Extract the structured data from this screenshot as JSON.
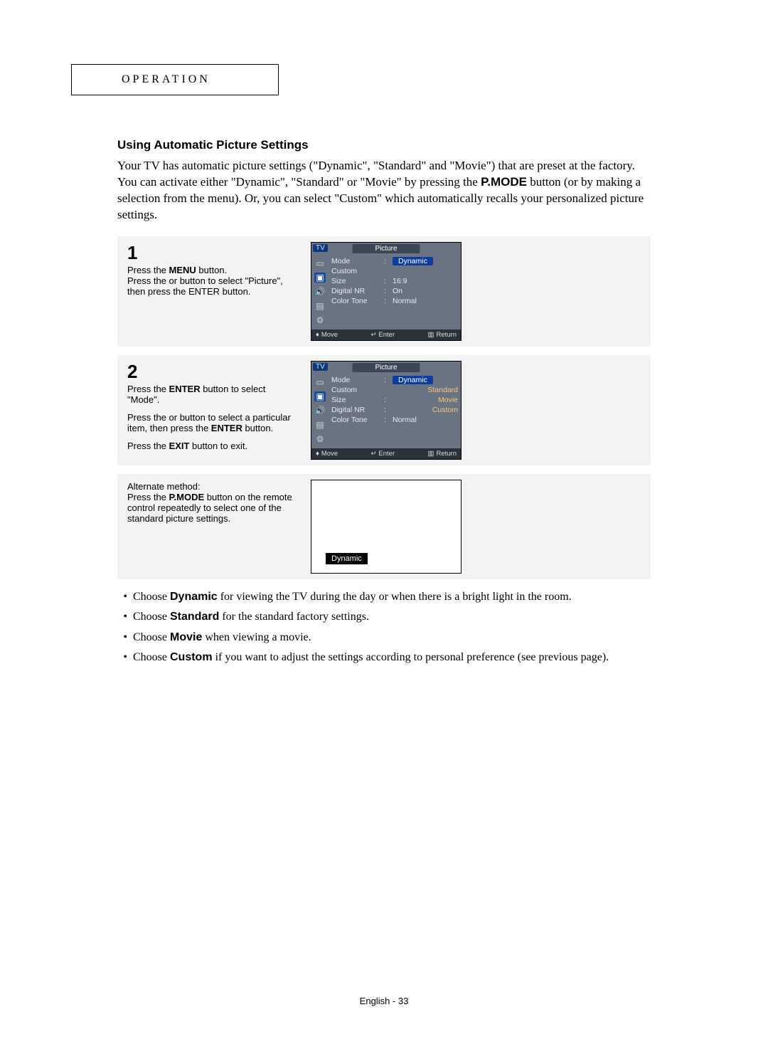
{
  "tab_label": "OPERATION",
  "section_title": "Using Automatic Picture Settings",
  "intro_part1": "Your TV has automatic picture settings (\"Dynamic\", \"Standard\" and \"Movie\") that are preset at the factory. You can activate either \"Dynamic\", \"Standard\" or \"Movie\" by pressing the ",
  "intro_bold": "P.MODE",
  "intro_part2": " button (or by making a selection from the menu). Or, you can select \"Custom\" which automatically recalls your personalized picture settings.",
  "step1": {
    "num": "1",
    "line1a": "Press the ",
    "line1b": "MENU",
    "line1c": " button.",
    "line2": "Press the      or      button to select \"Picture\", then press the ENTER button."
  },
  "step2": {
    "num": "2",
    "p1a": "Press the ",
    "p1b": "ENTER",
    "p1c": " button to select \"Mode\".",
    "p2": "Press the      or      button to select a particular item, then press the ",
    "p2b": "ENTER",
    "p2c": " button.",
    "p3a": "Press the ",
    "p3b": "EXIT",
    "p3c": " button to exit."
  },
  "step3": {
    "p1": "Alternate method:",
    "p2a": "Press the ",
    "p2b": "P.MODE",
    "p2c": " button on the remote control repeatedly to select one of the standard picture settings."
  },
  "osd1": {
    "tv": "TV",
    "title": "Picture",
    "rows": {
      "mode_l": "Mode",
      "mode_v": "Dynamic",
      "custom_l": "Custom",
      "size_l": "Size",
      "size_v": "16:9",
      "dnr_l": "Digital NR",
      "dnr_v": "On",
      "ct_l": "Color Tone",
      "ct_v": "Normal"
    },
    "footer": {
      "move": "Move",
      "enter": "Enter",
      "ret": "Return"
    }
  },
  "osd2": {
    "tv": "TV",
    "title": "Picture",
    "rows": {
      "mode_l": "Mode",
      "custom_l": "Custom",
      "size_l": "Size",
      "dnr_l": "Digital NR",
      "ct_l": "Color Tone",
      "ct_v": "Normal"
    },
    "opts": {
      "dynamic": "Dynamic",
      "standard": "Standard",
      "movie": "Movie",
      "custom": "Custom"
    },
    "footer": {
      "move": "Move",
      "enter": "Enter",
      "ret": "Return"
    }
  },
  "osd3_badge": "Dynamic",
  "bullets": {
    "b1a": "Choose ",
    "b1b": "Dynamic",
    "b1c": " for viewing the TV during the day or when there is a bright light in the room.",
    "b2a": "Choose ",
    "b2b": "Standard",
    "b2c": " for the standard factory settings.",
    "b3a": "Choose ",
    "b3b": "Movie",
    "b3c": " when viewing a movie.",
    "b4a": "Choose ",
    "b4b": "Custom",
    "b4c": " if you want to adjust the settings according to personal preference (see previous page)."
  },
  "footer": "English - 33"
}
